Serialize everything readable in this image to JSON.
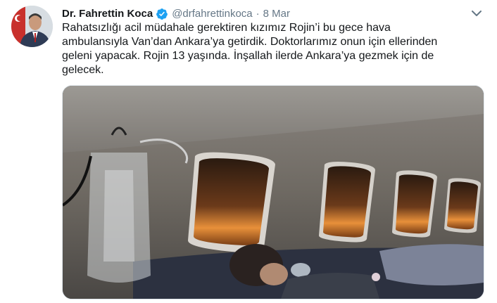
{
  "tweet": {
    "author_name": "Dr. Fahrettin Koca",
    "handle": "@drfahrettinkoca",
    "separator": "·",
    "timestamp": "8 Mar",
    "text_lines": [
      "Rahatsızlığı acil müdahale gerektiren kızımız Rojin’i bu gece hava",
      "ambulansıyla Van’dan Ankara’ya getirdik. Doktorlarımız onun için ellerinden",
      "geleni yapacak. Rojin 13 yaşında. İnşallah ilerde Ankara’ya gezmek için de",
      "gelecek."
    ],
    "verified": true,
    "icons": {
      "verified": "verified-badge-icon",
      "more": "chevron-down-icon"
    },
    "media": {
      "type": "photo",
      "description_icon": "photo"
    }
  },
  "colors": {
    "name": "#14171a",
    "secondary": "#657786",
    "verified": "#1da1f2",
    "border": "#e1e8ed"
  }
}
